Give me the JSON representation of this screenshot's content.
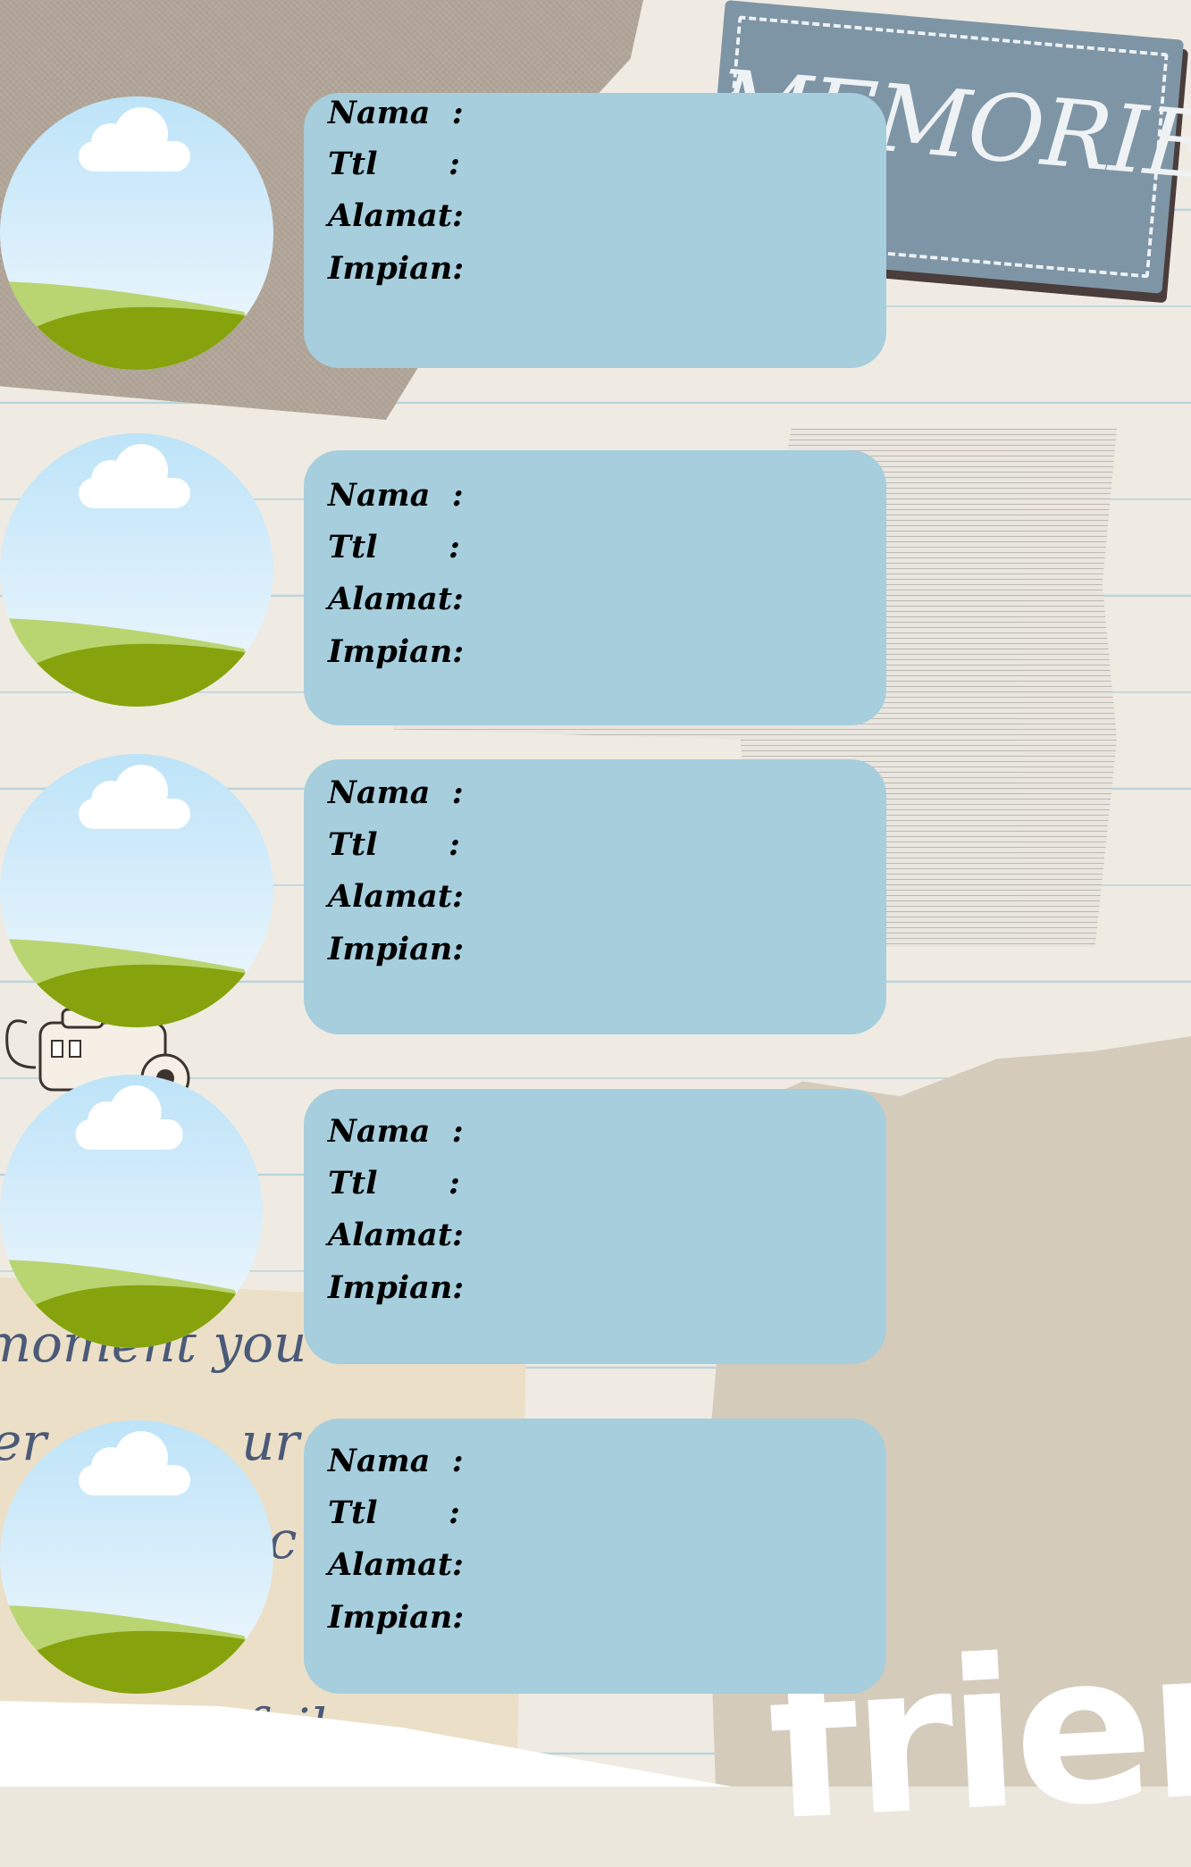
{
  "sign": {
    "text": "MEMORIES"
  },
  "decor": {
    "friends_text": "friends",
    "script_lines": [
      "moment you decid",
      "er",
      "ur",
      "c",
      "tion fail"
    ]
  },
  "cards": [
    {
      "nama_label": "Nama  :",
      "ttl_label": "Ttl",
      "ttl_colon": ":",
      "alamat_label": "Alamat:",
      "impian_label": "Impian:"
    },
    {
      "nama_label": "Nama  :",
      "ttl_label": "Ttl",
      "ttl_colon": ":",
      "alamat_label": "Alamat:",
      "impian_label": "Impian:"
    },
    {
      "nama_label": "Nama  :",
      "ttl_label": "Ttl",
      "ttl_colon": ":",
      "alamat_label": "Alamat:",
      "impian_label": "Impian:"
    },
    {
      "nama_label": "Nama  :",
      "ttl_label": "Ttl",
      "ttl_colon": ":",
      "alamat_label": "Alamat:",
      "impian_label": "Impian:"
    },
    {
      "nama_label": "Nama  :",
      "ttl_label": "Ttl",
      "ttl_colon": ":",
      "alamat_label": "Alamat:",
      "impian_label": "Impian:"
    }
  ],
  "colors": {
    "card": "#a6cedd",
    "sky_top": "#bde3f8",
    "grass_light": "#b9d572",
    "grass_dark": "#86a30d"
  }
}
